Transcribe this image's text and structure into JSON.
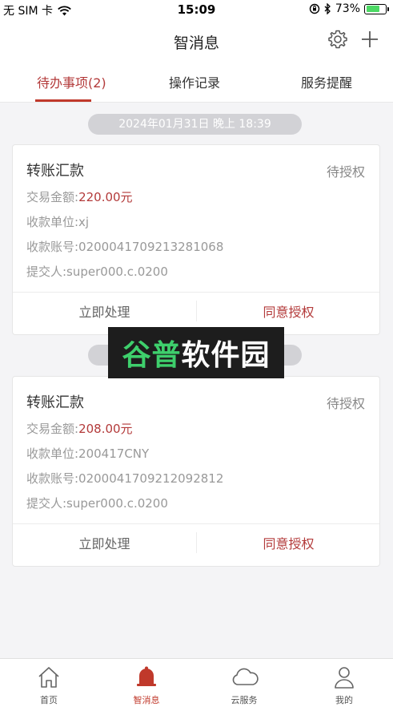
{
  "status_bar": {
    "carrier": "无 SIM 卡",
    "time": "15:09",
    "battery": "73%",
    "battery_level": 0.73
  },
  "nav": {
    "title": "智消息"
  },
  "tabs": [
    {
      "label": "待办事项(2)",
      "active": true
    },
    {
      "label": "操作记录",
      "active": false
    },
    {
      "label": "服务提醒",
      "active": false
    }
  ],
  "timestamp": "2024年01月31日 晚上 18:39",
  "cards": [
    {
      "title": "转账汇款",
      "status": "待授权",
      "amount_label": "交易金额:",
      "amount": "220.00元",
      "payee": "收款单位:xj",
      "account": "收款账号:0200041709213281068",
      "submitter": "提交人:super000.c.0200",
      "process_label": "立即处理",
      "approve_label": "同意授权"
    },
    {
      "title": "转账汇款",
      "status": "待授权",
      "amount_label": "交易金额:",
      "amount": "208.00元",
      "payee": "收款单位:200417CNY",
      "account": "收款账号:0200041709212092812",
      "submitter": "提交人:super000.c.0200",
      "process_label": "立即处理",
      "approve_label": "同意授权"
    }
  ],
  "watermark": {
    "brand_a": "谷普",
    "brand_b": "软件园"
  },
  "bottom_tabs": [
    {
      "label": "首页",
      "icon": "home-icon"
    },
    {
      "label": "智消息",
      "icon": "bell-icon",
      "active": true
    },
    {
      "label": "云服务",
      "icon": "cloud-icon"
    },
    {
      "label": "我的",
      "icon": "user-icon"
    }
  ],
  "colors": {
    "accent": "#c0392b",
    "amount": "#b33a3a"
  }
}
